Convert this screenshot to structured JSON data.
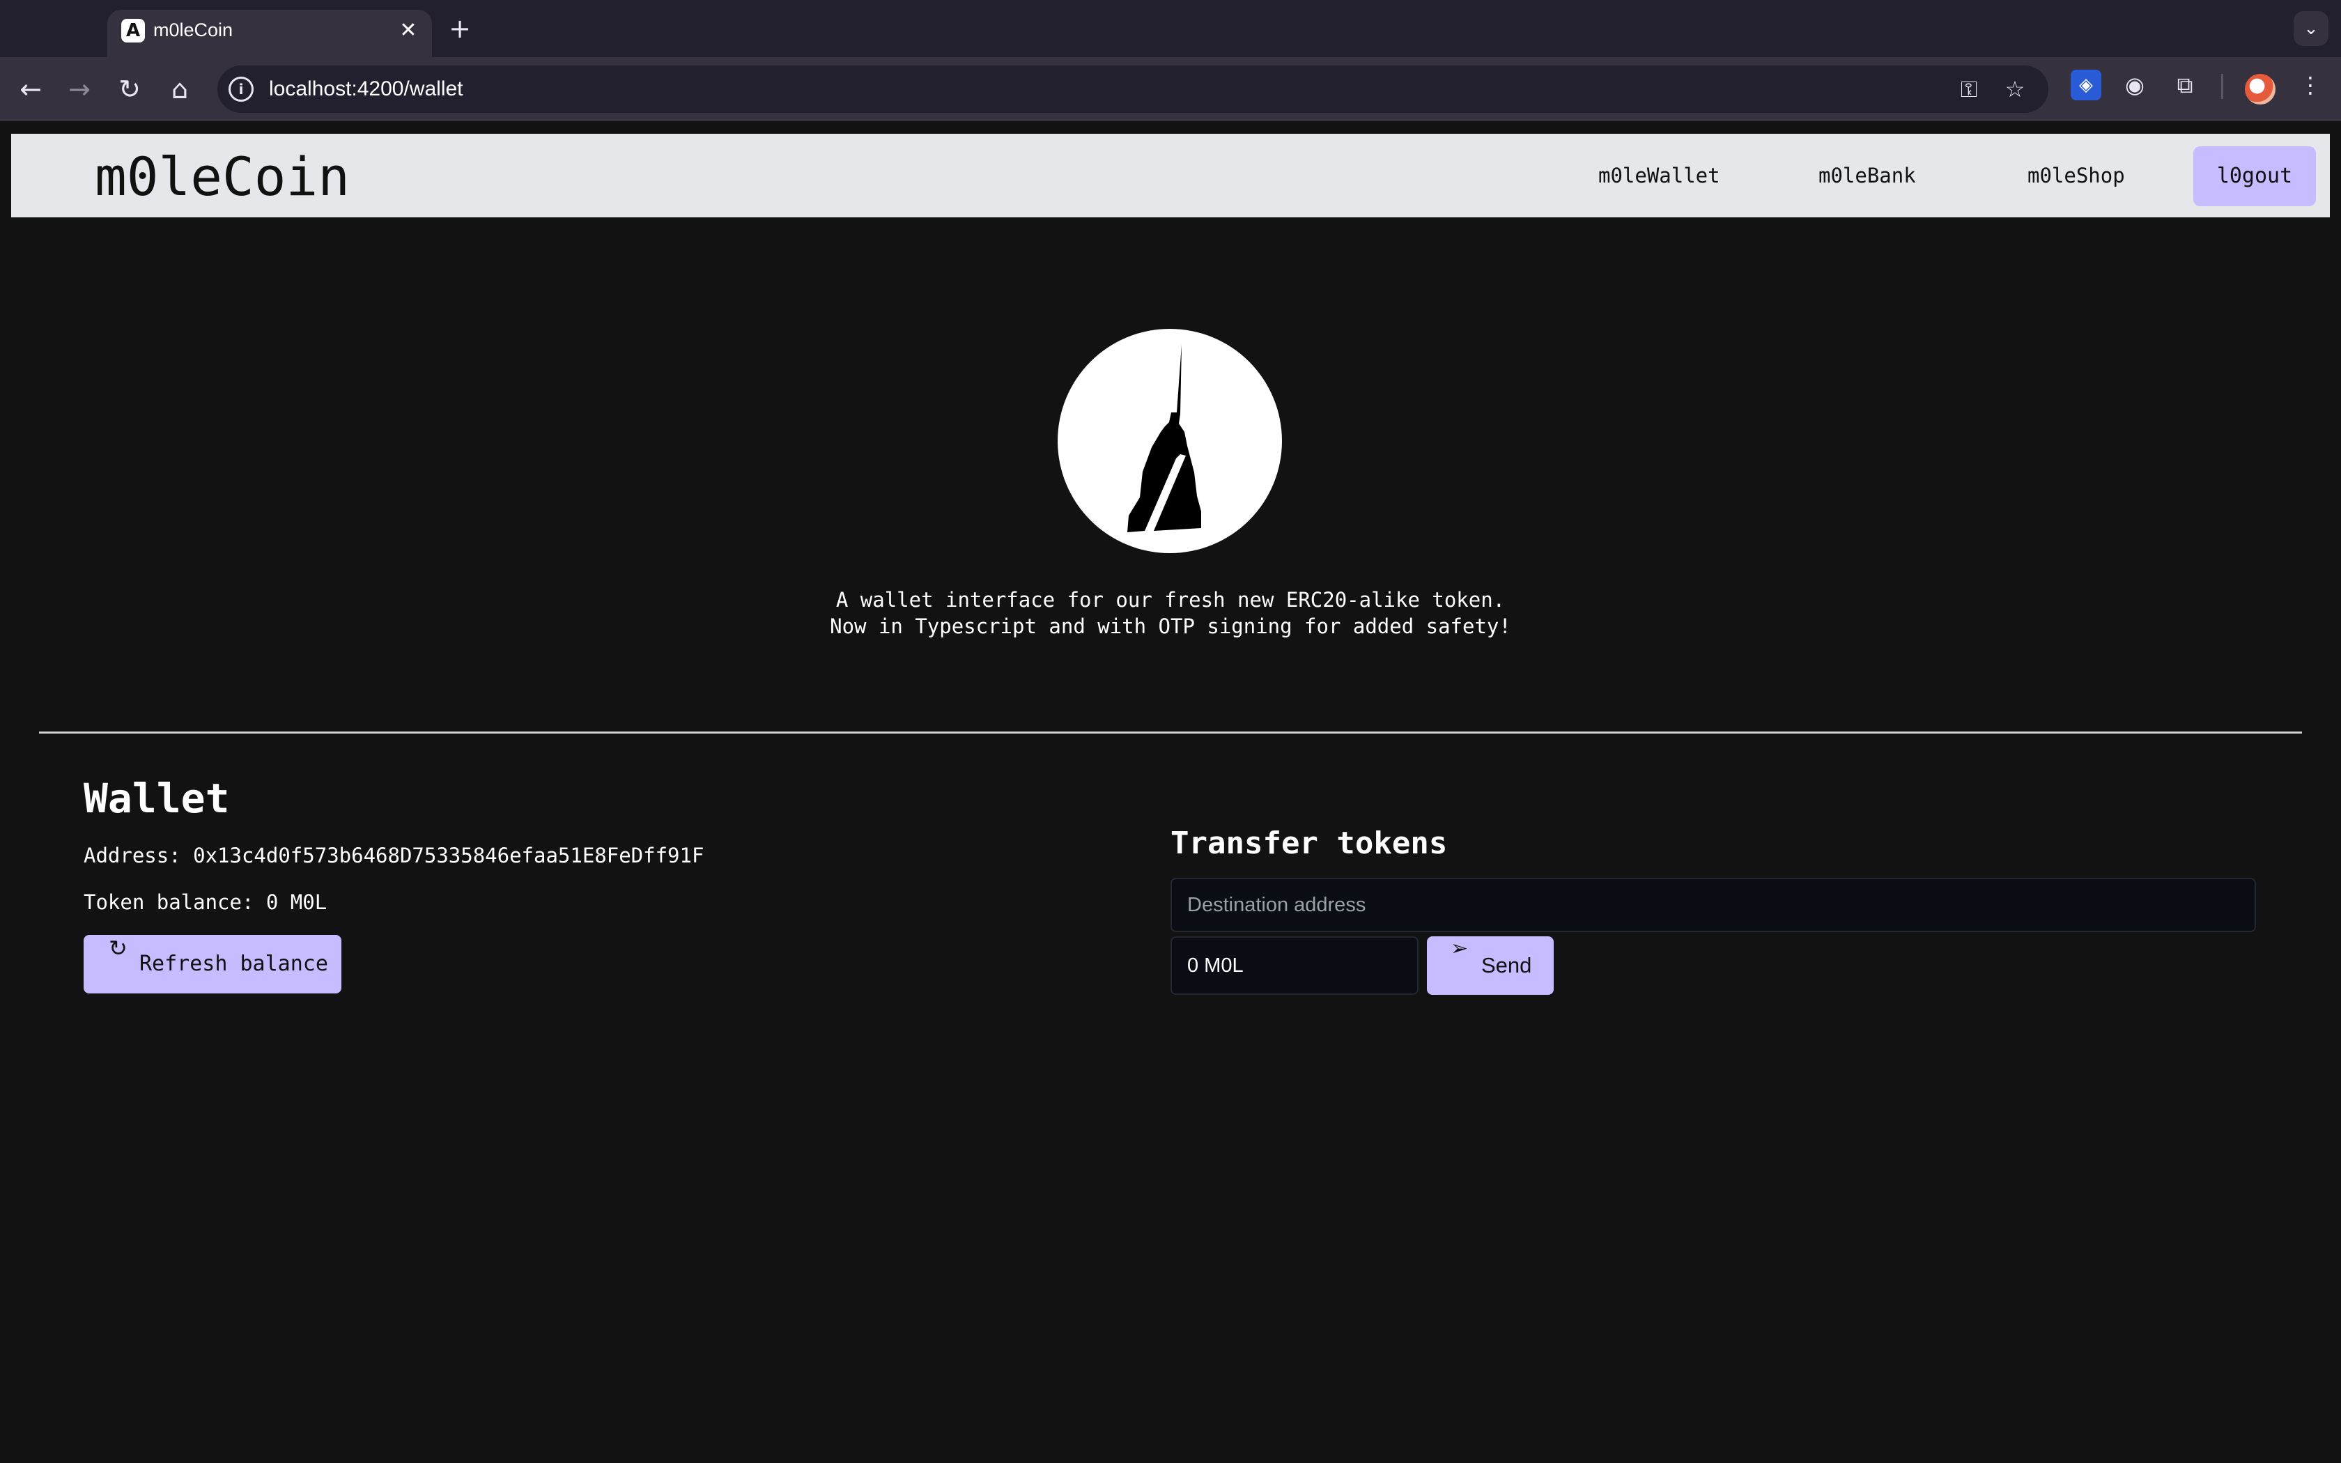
{
  "browser": {
    "tab": {
      "title": "m0leCoin",
      "favicon": "angular-icon",
      "favicon_glyph": "A"
    },
    "url": "localhost:4200/wallet",
    "icons": [
      "back-icon",
      "forward-icon",
      "reload-icon",
      "home-icon",
      "site-info-icon",
      "password-key-icon",
      "bookmark-star-icon",
      "bitwarden-icon",
      "incognito-icon",
      "extensions-icon",
      "profile-avatar",
      "more-menu-icon"
    ]
  },
  "header": {
    "brand": "m0leCoin",
    "nav": [
      "m0leWallet",
      "m0leBank",
      "m0leShop"
    ],
    "logout": "l0gout"
  },
  "hero": {
    "logo": "mole-antonelliana-logo",
    "tagline_1": "A wallet interface for our fresh new ERC20-alike token.",
    "tagline_2": "Now in Typescript and with OTP signing for added safety!"
  },
  "wallet": {
    "title": "Wallet",
    "address": "Address: 0x13c4d0f573b6468D75335846efaa51E8FeDff91F",
    "balance": "Token balance: 0 M0L",
    "refresh_label": "Refresh balance"
  },
  "transfer": {
    "title": "Transfer tokens",
    "destination_placeholder": "Destination address",
    "amount_value": "0 M0L",
    "send_label": "Send"
  },
  "colors": {
    "page_bg": "#121212",
    "header_bg": "#e6e7ea",
    "accent": "#c6bcff",
    "input_bg": "#0a0e14"
  }
}
